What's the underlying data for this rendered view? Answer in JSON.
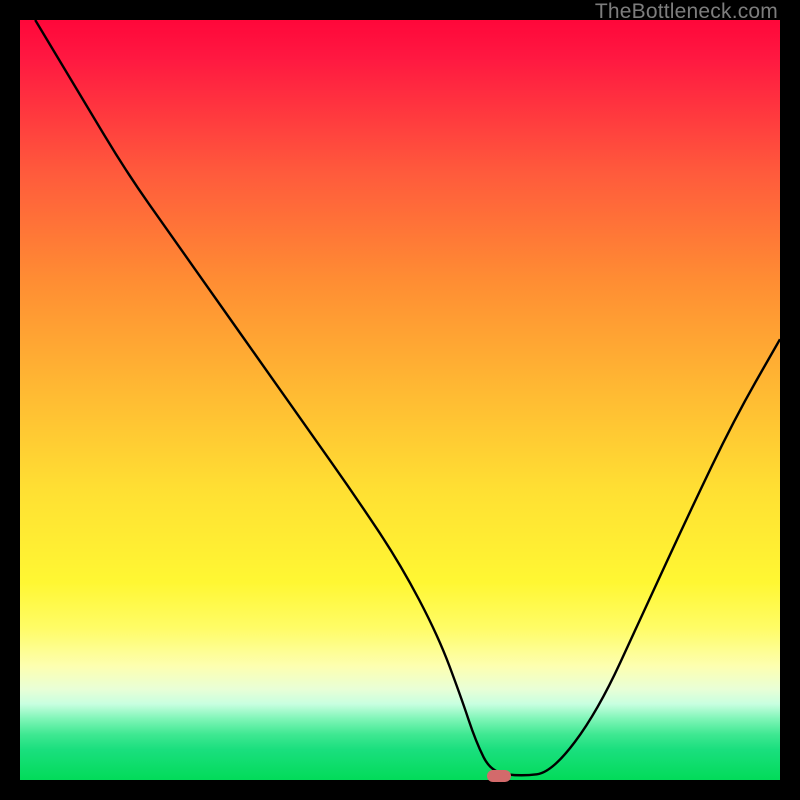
{
  "watermark": "TheBottleneck.com",
  "colors": {
    "frame": "#000000",
    "curve": "#000000",
    "marker": "#d36a6b",
    "gradient_stops": [
      {
        "pct": 0,
        "hex": "#ff073a"
      },
      {
        "pct": 5,
        "hex": "#ff1841"
      },
      {
        "pct": 20,
        "hex": "#ff5a3c"
      },
      {
        "pct": 34,
        "hex": "#ff8c33"
      },
      {
        "pct": 48,
        "hex": "#ffb733"
      },
      {
        "pct": 62,
        "hex": "#ffe033"
      },
      {
        "pct": 74,
        "hex": "#fff733"
      },
      {
        "pct": 80,
        "hex": "#fffc66"
      },
      {
        "pct": 85,
        "hex": "#fdffb0"
      },
      {
        "pct": 88,
        "hex": "#e9ffd6"
      },
      {
        "pct": 90,
        "hex": "#c8ffe0"
      },
      {
        "pct": 92,
        "hex": "#7df5b6"
      },
      {
        "pct": 94,
        "hex": "#3fe892"
      },
      {
        "pct": 96,
        "hex": "#1adf7e"
      },
      {
        "pct": 100,
        "hex": "#02db59"
      }
    ]
  },
  "chart_data": {
    "type": "line",
    "title": "",
    "xlabel": "",
    "ylabel": "",
    "xlim": [
      0,
      100
    ],
    "ylim": [
      0,
      100
    ],
    "series": [
      {
        "name": "bottleneck-curve",
        "x": [
          2,
          8,
          14,
          20,
          26,
          32,
          38,
          44,
          50,
          55,
          58,
          60,
          62,
          66,
          70,
          76,
          82,
          88,
          94,
          100
        ],
        "y": [
          100,
          90,
          80,
          71.5,
          63,
          54.5,
          46,
          37.5,
          28.5,
          19,
          11,
          5,
          1,
          0.5,
          1,
          9,
          22,
          35,
          47.5,
          58
        ]
      }
    ],
    "markers": [
      {
        "name": "optimal-point",
        "x": 63,
        "y": 0.5
      }
    ],
    "background": "vertical-heat-gradient"
  }
}
